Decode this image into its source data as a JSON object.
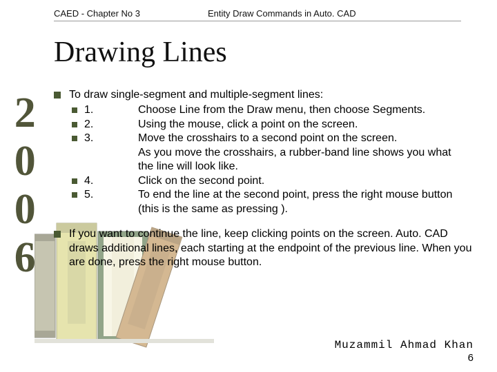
{
  "header": {
    "left": "CAED - Chapter No 3",
    "right": "Entity Draw Commands in Auto. CAD"
  },
  "title": "Drawing Lines",
  "sidebar_year": "2006",
  "intro": "To draw single-segment and multiple-segment lines:",
  "steps": [
    {
      "num": "1.",
      "desc": "Choose Line from the Draw menu, then choose Segments."
    },
    {
      "num": "2.",
      "desc": "Using the mouse, click a point on the screen."
    },
    {
      "num": "3.",
      "desc": "Move the crosshairs to a second point on the screen.\nAs you move the crosshairs, a rubber-band line shows you what the line will look like."
    },
    {
      "num": "4.",
      "desc": "Click on the second point."
    },
    {
      "num": "5.",
      "desc": "To end the line at the second point, press the right mouse button (this is the same as pressing )."
    }
  ],
  "continue": "If you want to continue the line, keep clicking points on the screen. Auto. CAD draws additional lines, each starting at the endpoint of the previous line. When you are done, press the right mouse button.",
  "footer": {
    "author": "Muzammil Ahmad Khan",
    "page": "6"
  }
}
